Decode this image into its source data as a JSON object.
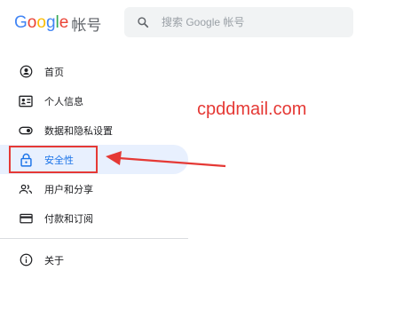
{
  "header": {
    "logo": {
      "letters": [
        "G",
        "o",
        "o",
        "g",
        "l",
        "e"
      ],
      "letter_colors": [
        "#4285F4",
        "#EA4335",
        "#FBBC05",
        "#4285F4",
        "#34A853",
        "#EA4335"
      ],
      "suffix": "帐号"
    },
    "search": {
      "placeholder": "搜索 Google 帐号",
      "value": "",
      "icon": "search-icon"
    }
  },
  "sidebar": {
    "items": [
      {
        "label": "首页",
        "icon": "home-icon"
      },
      {
        "label": "个人信息",
        "icon": "personal-info-icon"
      },
      {
        "label": "数据和隐私设置",
        "icon": "data-privacy-toggle-icon"
      },
      {
        "label": "安全性",
        "icon": "security-lock-icon",
        "active": true
      },
      {
        "label": "用户和分享",
        "icon": "people-sharing-icon"
      },
      {
        "label": "付款和订阅",
        "icon": "payment-card-icon"
      }
    ],
    "about": {
      "label": "关于",
      "icon": "info-icon"
    }
  },
  "annotation": {
    "watermark": "cpddmail.com",
    "highlight_color": "#e53935"
  },
  "colors": {
    "accent": "#1a73e8",
    "active_bg": "#e8f0fe"
  }
}
